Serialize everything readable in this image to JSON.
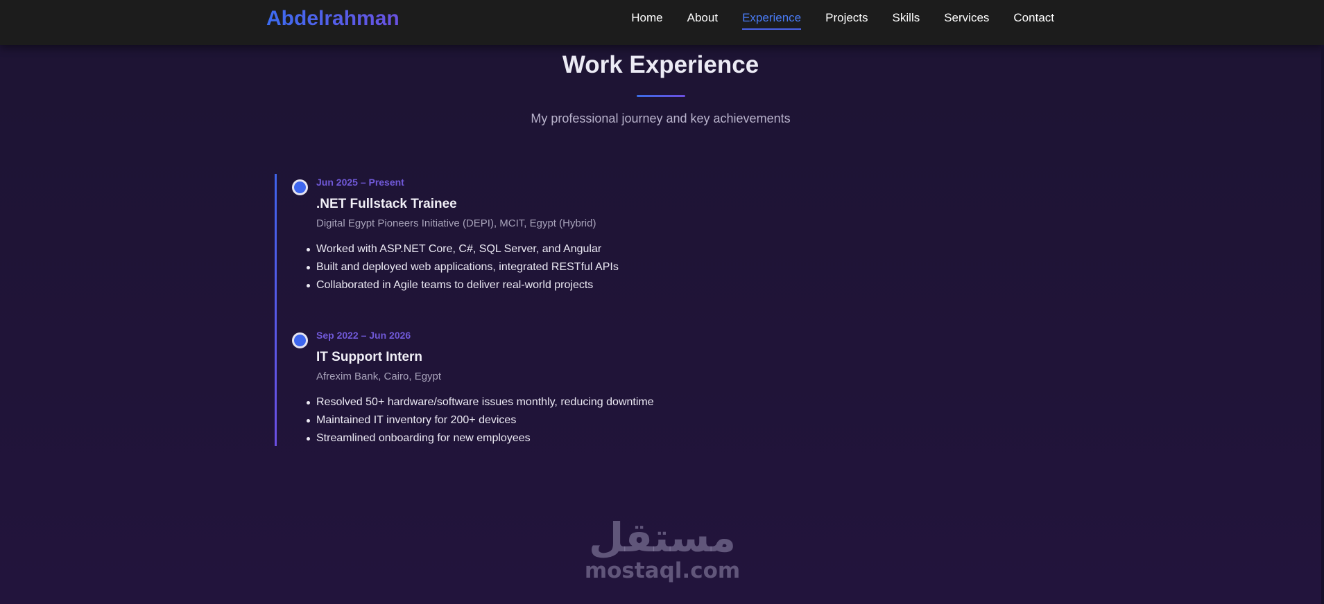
{
  "nav": {
    "brand": "Abdelrahman",
    "links": [
      "Home",
      "About",
      "Experience",
      "Projects",
      "Skills",
      "Services",
      "Contact"
    ],
    "active": "Experience"
  },
  "section": {
    "title": "Work Experience",
    "subtitle": "My professional journey and key achievements"
  },
  "experience": [
    {
      "date": "Jun 2025 – Present",
      "role": ".NET Fullstack Trainee",
      "org": "Digital Egypt Pioneers Initiative (DEPI), MCIT, Egypt (Hybrid)",
      "points": [
        "Worked with ASP.NET Core, C#, SQL Server, and Angular",
        "Built and deployed web applications, integrated RESTful APIs",
        "Collaborated in Agile teams to deliver real-world projects"
      ]
    },
    {
      "date": "Sep 2022 – Jun 2026",
      "role": "IT Support Intern",
      "org": "Afrexim Bank, Cairo, Egypt",
      "points": [
        "Resolved 50+ hardware/software issues monthly, reducing downtime",
        "Maintained IT inventory for 200+ devices",
        "Streamlined onboarding for new employees"
      ]
    }
  ],
  "watermark": {
    "arabic": "مستقل",
    "latin": "mostaql.com"
  },
  "colors": {
    "accent": "#4a7bf5",
    "accent_purple": "#6c4fe3",
    "background": "#1d1433",
    "navbar": "#1c1c1c"
  }
}
